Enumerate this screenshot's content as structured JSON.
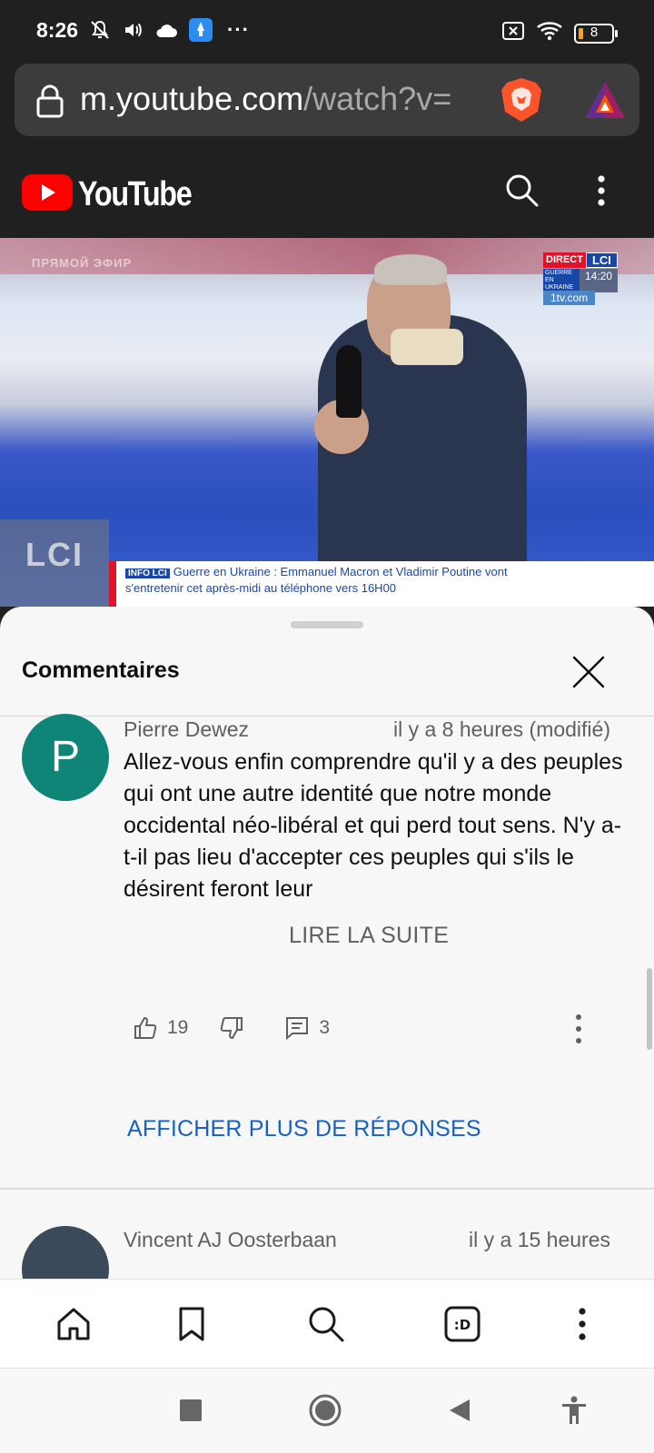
{
  "status_bar": {
    "time": "8:26",
    "battery": "8",
    "overflow": "···"
  },
  "url_bar": {
    "host": "m.youtube.com",
    "path": "/watch?v="
  },
  "youtube_header": {
    "brand": "YouTube"
  },
  "video": {
    "ghost_text": "ПРЯМОЙ ЭФИР",
    "badge_direct": "DIRECT",
    "badge_lci": "LCI",
    "badge_guerre": "GUERRE EN UKRAINE",
    "badge_time": "14:20",
    "tv_channel": "1tv.com",
    "watermark": "LCI",
    "ticker_tag": "INFO LCI",
    "ticker_line1": "Guerre en Ukraine : Emmanuel Macron et Vladimir Poutine vont",
    "ticker_line2": "s'entretenir cet après-midi au téléphone vers 16H00"
  },
  "comments_panel": {
    "title": "Commentaires",
    "comments": [
      {
        "avatar_letter": "P",
        "author": "Pierre Dewez",
        "time": "il y a 8 heures (modifié)",
        "text": "Allez-vous enfin comprendre qu'il y a des peuples qui ont une autre identité que notre monde occidental néo-libéral et qui perd tout sens.  N'y a-t-il pas lieu d'accepter ces peuples qui s'ils le désirent feront leur",
        "read_more": "LIRE LA SUITE",
        "likes": "19",
        "replies": "3",
        "more_replies": "AFFICHER PLUS DE RÉPONSES"
      },
      {
        "avatar_letter": "",
        "author": "Vincent AJ Oosterbaan",
        "time": "il y a 15 heures"
      }
    ]
  },
  "colors": {
    "accent_blue": "#1762c0",
    "youtube_red": "#ff0000",
    "avatar_teal": "#0f8577"
  }
}
